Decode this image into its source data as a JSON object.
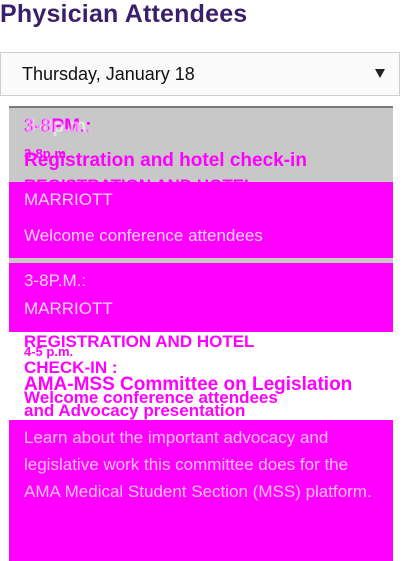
{
  "page": {
    "title": "Physician Attendees"
  },
  "date_select": {
    "value": "Thursday, January 18"
  },
  "events": [
    {
      "time_a": "3-8PM.:",
      "time_b": "3-8p.m.",
      "title": "Registration and hotel check-in",
      "title_caps": "REGISTRATION AND HOTEL",
      "venue_ghost": "MARRIOTT",
      "desc_ghost": "Welcome conference attendees"
    },
    {
      "time_ghost": "3-8P.M.:",
      "venue_ghost": "MARRIOTT",
      "title_caps_1": "REGISTRATION AND HOTEL",
      "title_caps_2": "CHECK-IN :",
      "time": "4-5 p.m.",
      "title": "AMA-MSS Committee on Legislation",
      "title_2": "and Advocacy presentation",
      "desc": "Welcome conference attendees"
    },
    {
      "desc_ghost": "Learn about the important advocacy and legislative work this committee does for the AMA Medical Student Section (MSS) platform."
    }
  ]
}
